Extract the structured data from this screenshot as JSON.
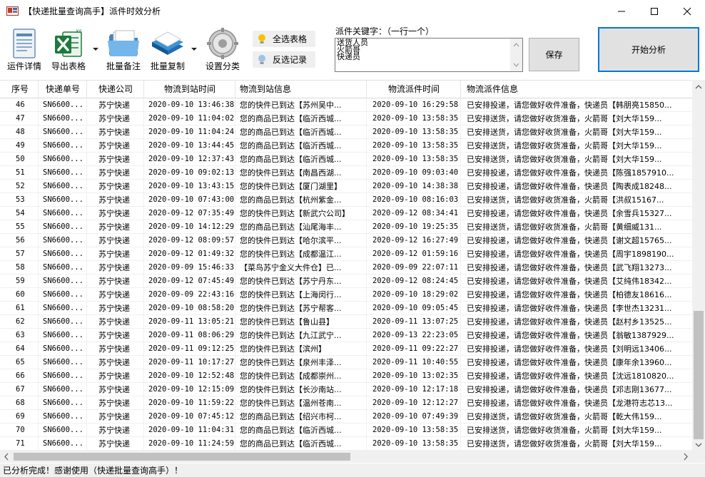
{
  "window": {
    "title": "【快递批量查询高手】派件时效分析"
  },
  "toolbar": {
    "buttons": [
      {
        "label": "运件详情",
        "icon": "document-icon"
      },
      {
        "label": "导出表格",
        "icon": "excel-icon"
      },
      {
        "label": "批量备注",
        "icon": "folder-icon"
      },
      {
        "label": "批量复制",
        "icon": "copy-icon"
      },
      {
        "label": "设置分类",
        "icon": "gear-icon"
      }
    ],
    "select_all": "全选表格",
    "invert_select": "反选记录",
    "keyword_label": "派件关键字：（一行一个）",
    "keywords": "送货人员\n火箭哥\n快递员",
    "save": "保存",
    "start": "开始分析"
  },
  "table": {
    "columns": [
      "序号",
      "快递单号",
      "快递公司",
      "物流到站时间",
      "物流到站信息",
      "物流派件时间",
      "物流派件信息"
    ],
    "rows": [
      [
        "46",
        "SN6600...",
        "苏宁快递",
        "2020-09-10 13:46:38",
        "您的快件已到达【苏州吴中...",
        "2020-09-10 16:29:58",
        "已安排投递，请您做好收件准备，快递员【韩朋亮15850..."
      ],
      [
        "47",
        "SN6600...",
        "苏宁快递",
        "2020-09-10 11:04:02",
        "您的商品已到达【临沂西城...",
        "2020-09-10 13:58:35",
        "已安排送货，请您做好收货准备，火箭哥【刘大华159..."
      ],
      [
        "48",
        "SN6600...",
        "苏宁快递",
        "2020-09-10 11:04:24",
        "您的商品已到达【临沂西城...",
        "2020-09-10 13:58:35",
        "已安排送货，请您做好收货准备，火箭哥【刘大华159..."
      ],
      [
        "49",
        "SN6600...",
        "苏宁快递",
        "2020-09-10 13:44:45",
        "您的商品已到达【临沂西城...",
        "2020-09-10 13:58:35",
        "已安排送货，请您做好收货准备，火箭哥【刘大华159..."
      ],
      [
        "50",
        "SN6600...",
        "苏宁快递",
        "2020-09-10 12:37:43",
        "您的商品已到达【临沂西城...",
        "2020-09-10 13:58:35",
        "已安排送货，请您做好收货准备，火箭哥【刘大华159..."
      ],
      [
        "51",
        "SN6600...",
        "苏宁快递",
        "2020-09-10 09:02:13",
        "您的快件已到达【南昌西湖...",
        "2020-09-10 09:03:40",
        "已安排投递，请您做好收件准备，快递员【陈强1857910..."
      ],
      [
        "52",
        "SN6600...",
        "苏宁快递",
        "2020-09-10 13:43:15",
        "您的快件已到达【厦门湖里】",
        "2020-09-10 14:38:38",
        "已安排投递，请您做好收件准备，快递员【陶表成18248..."
      ],
      [
        "53",
        "SN6600...",
        "苏宁快递",
        "2020-09-10 07:43:00",
        "您的商品已到达【杭州紫金...",
        "2020-09-10 08:16:03",
        "已安排送货，请您做好收货准备，火箭哥【洪叔15167..."
      ],
      [
        "54",
        "SN6600...",
        "苏宁快递",
        "2020-09-12 07:35:49",
        "您的快件已到达【新武穴公司】",
        "2020-09-12 08:34:41",
        "已安排投递，请您做好收件准备，快递员【余雪兵15327..."
      ],
      [
        "55",
        "SN6600...",
        "苏宁快递",
        "2020-09-10 14:12:29",
        "您的商品已到达【汕尾海丰...",
        "2020-09-10 19:25:35",
        "已安排送货，请您做好收货准备，火箭哥【黄细威131..."
      ],
      [
        "56",
        "SN6600...",
        "苏宁快递",
        "2020-09-12 08:09:57",
        "您的快件已到达【哈尔滨平...",
        "2020-09-12 16:27:49",
        "已安排投递，请您做好收件准备，快递员【谢文超15765..."
      ],
      [
        "57",
        "SN6600...",
        "苏宁快递",
        "2020-09-12 01:49:32",
        "您的快件已到达【成都温江...",
        "2020-09-12 01:59:16",
        "已安排投递，请您做好收件准备，快递员【周宇1898190..."
      ],
      [
        "58",
        "SN6600...",
        "苏宁快递",
        "2020-09-09 15:46:33",
        "【菜鸟苏宁金义大件仓】已...",
        "2020-09-09 22:07:11",
        "已安排投递，请您做好收件准备，快递员【武飞翔13273..."
      ],
      [
        "59",
        "SN6600...",
        "苏宁快递",
        "2020-09-12 07:45:49",
        "您的快件已到达【苏宁丹东...",
        "2020-09-12 08:24:45",
        "已安排投递，请您做好收件准备，快递员【艾纯伟18342..."
      ],
      [
        "60",
        "SN6600...",
        "苏宁快递",
        "2020-09-09 22:43:16",
        "您的快件已到达【上海闵行...",
        "2020-09-10 18:29:02",
        "已安排投递，请您做好收件准备，快递员【柏德友18616..."
      ],
      [
        "61",
        "SN6600...",
        "苏宁快递",
        "2020-09-10 08:58:20",
        "您的快件已到达【苏宁帮客...",
        "2020-09-10 09:05:45",
        "已安排投递，请您做好收件准备，快递员【李世杰13231..."
      ],
      [
        "62",
        "SN6600...",
        "苏宁快递",
        "2020-09-11 13:05:21",
        "您的快件已到达【鲁山县】",
        "2020-09-11 13:07:25",
        "已安排投递，请您做好收件准备，快递员【赵村乡13525..."
      ],
      [
        "63",
        "SN6600...",
        "苏宁快递",
        "2020-09-11 08:06:29",
        "您的快件已到达【九江武宁...",
        "2020-09-13 22:23:05",
        "已安排投递，请您做好收件准备，快递员【翁敏1387929..."
      ],
      [
        "64",
        "SN6600...",
        "苏宁快递",
        "2020-09-11 09:12:25",
        "您的快件已到达【滨州】",
        "2020-09-11 09:22:27",
        "已安排投递，请您做好收件准备，快递员【刘明远13406..."
      ],
      [
        "65",
        "SN6600...",
        "苏宁快递",
        "2020-09-11 10:17:27",
        "您的快件已到达【泉州丰泽...",
        "2020-09-11 10:40:55",
        "已安排投递，请您做好收件准备，快递员【康年余13960..."
      ],
      [
        "66",
        "SN6600...",
        "苏宁快递",
        "2020-09-10 12:52:48",
        "您的快件已到达【成都崇州...",
        "2020-09-10 13:02:35",
        "已安排投递，请您做好收件准备，快递员【沈远1810820..."
      ],
      [
        "67",
        "SN6600...",
        "苏宁快递",
        "2020-09-10 12:15:09",
        "您的快件已到达【长沙南站...",
        "2020-09-10 12:17:18",
        "已安排投递，请您做好收件准备，快递员【邓志刚13677..."
      ],
      [
        "68",
        "SN6600...",
        "苏宁快递",
        "2020-09-10 11:59:22",
        "您的快件已到达【温州苍南...",
        "2020-09-10 12:12:27",
        "已安排投递，请您做好收件准备，快递员【龙港符志芯13..."
      ],
      [
        "69",
        "SN6600...",
        "苏宁快递",
        "2020-09-10 07:45:12",
        "您的商品已到达【绍兴市柯...",
        "2020-09-10 07:49:39",
        "已安排送货，请您做好收货准备，火箭哥【乾大伟159..."
      ],
      [
        "70",
        "SN6600...",
        "苏宁快递",
        "2020-09-10 11:04:31",
        "您的商品已到达【临沂西城...",
        "2020-09-10 13:58:35",
        "已安排送货，请您做好收货准备，火箭哥【刘大华159..."
      ],
      [
        "71",
        "SN6600...",
        "苏宁快递",
        "2020-09-10 11:24:59",
        "您的商品已到达【临沂西城...",
        "2020-09-10 13:58:35",
        "已安排送货，请您做好收货准备，火箭哥【刘大华159..."
      ]
    ]
  },
  "status": {
    "text": "已分析完成！感谢使用（快递批量查询高手）！"
  },
  "colors": {
    "accent": "#0078d7",
    "excel": "#1d7a3c",
    "folder": "#5aa7e0"
  }
}
